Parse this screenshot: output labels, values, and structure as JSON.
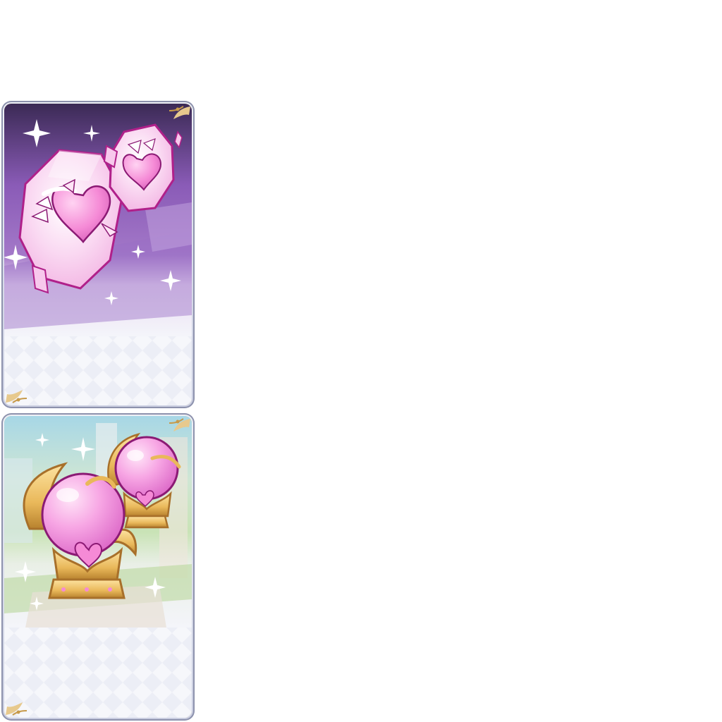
{
  "cards": [
    {
      "item": "heart-crystal",
      "colors": {
        "background_top": "#3b2a55",
        "background_mid": "#8a5bb7",
        "crystal_fill": "#f7c8ec",
        "crystal_edge": "#b0208a",
        "heart": "#f58ad6"
      }
    },
    {
      "item": "heart-orb-pedestal",
      "colors": {
        "background_top": "#a7d7e6",
        "background_mid": "#c9e3b6",
        "orb": "#f38fdc",
        "gold": "#e9b85a",
        "gold_dark": "#a8702a"
      }
    }
  ],
  "frame": {
    "border_color": "#8d92ad",
    "gold_trim": "#e7c98d"
  }
}
